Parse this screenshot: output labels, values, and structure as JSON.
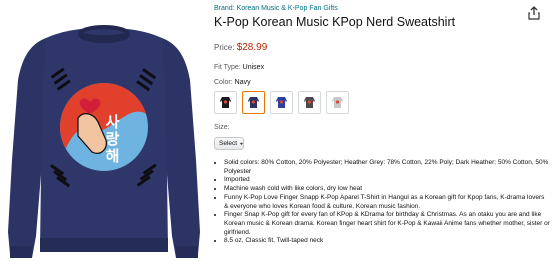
{
  "brand": "Brand: Korean Music & K-Pop Fan Gifts",
  "title": "K-Pop Korean Music KPop Nerd Sweatshirt",
  "price": {
    "label": "Price:",
    "value": "$28.99"
  },
  "fit_type": {
    "label": "Fit Type:",
    "value": "Unisex"
  },
  "color": {
    "label": "Color:",
    "value": "Navy",
    "options": [
      {
        "name": "Black",
        "hex": "#1b1b1f"
      },
      {
        "name": "Navy",
        "hex": "#2c3360"
      },
      {
        "name": "Royal Blue",
        "hex": "#2e3fa0"
      },
      {
        "name": "Dark Heather",
        "hex": "#4a4a4e"
      },
      {
        "name": "Heather Grey",
        "hex": "#c7c7c9"
      }
    ],
    "selected_index": 1
  },
  "size": {
    "label": "Size:",
    "select_label": "Select"
  },
  "image": {
    "hangul": "사랑해"
  },
  "bullets": [
    "Solid colors: 80% Cotton, 20% Polyester; Heather Grey: 78% Cotton, 22% Poly; Dark Heather: 50% Cotton, 50% Polyester",
    "Imported",
    "Machine wash cold with like colors, dry low heat",
    "Funny K-Pop Love Finger Snapp K-Pop Aparel T-Shirt in Hangul as a Korean gift for Kpop fans, K-drama lovers & everyone who loves Korean food & culture. Korean music fashion.",
    "Finger Snap K-Pop gift for every fan of KPop & KDrama for birthday & Christmas. As an otaku you are and like Korean music & Korean drama. Korean finger heart shirt for K-Pop & Kawaii Anime fans whether mother, sister or girlfriend.",
    "8.5 oz, Classic fit, Twill-taped neck"
  ],
  "colors": {
    "link": "#007185",
    "price": "#b12704",
    "selected_border": "#e77600",
    "sweatshirt": "#2c3365"
  },
  "icons": {
    "share": "share-icon",
    "dropdown": "chevron-down-icon"
  }
}
